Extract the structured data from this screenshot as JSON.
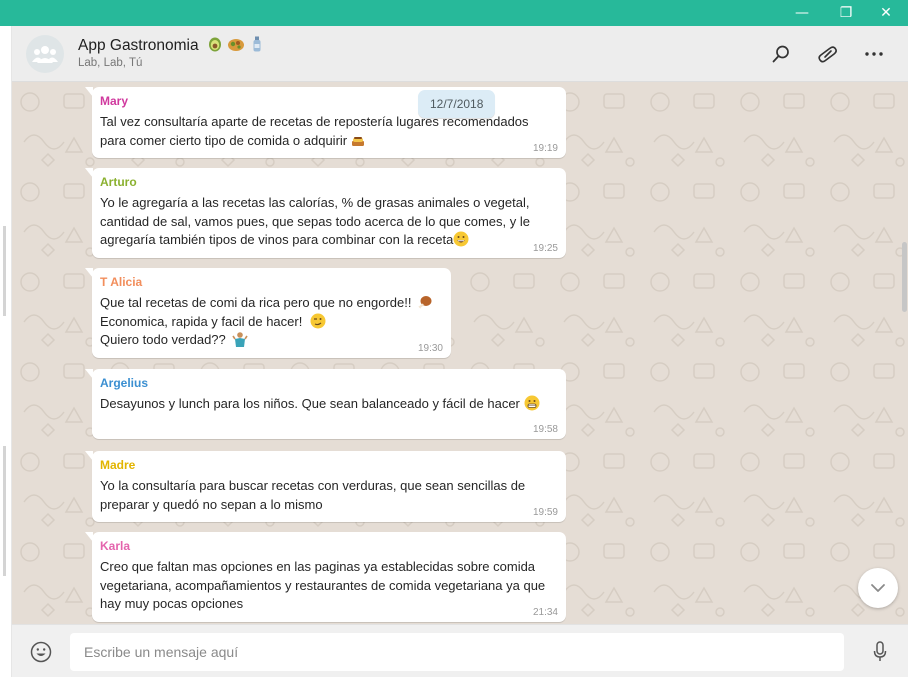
{
  "window": {
    "minimize_glyph": "—",
    "maximize_glyph": "❐",
    "close_glyph": "✕"
  },
  "header": {
    "title": "App Gastronomia",
    "title_emojis": [
      "avocado-emoji",
      "falafel-emoji",
      "bottle-emoji"
    ],
    "subtitle": "Lab, Lab, Tú",
    "avatar_icon": "group-icon",
    "actions": [
      "search-icon",
      "attach-icon",
      "more-icon"
    ]
  },
  "chat": {
    "date_chip": "12/7/2018",
    "messages": [
      {
        "sender": "Mary",
        "sender_color": "#d0399e",
        "text": "Tal vez consultaría aparte de recetas de repostería lugares recomendados\npara comer cierto tipo de comida o adquirir",
        "emoji": "custard-emoji",
        "time": "19:19"
      },
      {
        "sender": "Arturo",
        "sender_color": "#8bb130",
        "text": "Yo le agregaría a las recetas las calorías,  % de grasas animales o vegetal,\ncantidad de sal, vamos pues, que sepas todo acerca de lo que comes, y le\nagregaría también tipos de vinos para combinar con la receta",
        "emoji": "grinning-emoji",
        "time": "19:25"
      },
      {
        "sender": "T Alicia",
        "sender_color": "#f28e5c",
        "lines": [
          {
            "text": "Que tal recetas de comi da rica pero que no engorde!!",
            "emoji": "poultry-leg-emoji"
          },
          {
            "text": "Economica, rapida y facil de hacer!",
            "emoji": "winking-emoji"
          },
          {
            "text": "Quiero todo verdad??",
            "emoji": "shrug-emoji"
          }
        ],
        "time": "19:30"
      },
      {
        "sender": "Argelius",
        "sender_color": "#3b8fd1",
        "text": "Desayunos y lunch para los niños. Que sean balanceado y fácil de hacer",
        "emoji": "grimacing-emoji",
        "time": "19:58"
      },
      {
        "sender": "Madre",
        "sender_color": "#e2b400",
        "text": "Yo la consultaría para buscar recetas con verduras, que sean sencillas de\npreparar y quedó no sepan a lo mismo",
        "time": "19:59"
      },
      {
        "sender": "Karla",
        "sender_color": "#e464ad",
        "text": "Creo que faltan mas opciones en las paginas ya establecidas sobre comida\nvegetariana, acompañamientos y restaurantes de comida vegetariana ya que\nhay muy pocas opciones",
        "time": "21:34"
      }
    ]
  },
  "composer": {
    "placeholder": "Escribe un mensaje aquí",
    "emoji_icon": "smiley-icon",
    "mic_icon": "microphone-icon"
  },
  "colors": {
    "titlebar": "#27b99a",
    "chat_bg": "#e5ddd5",
    "bubble": "#ffffff"
  }
}
